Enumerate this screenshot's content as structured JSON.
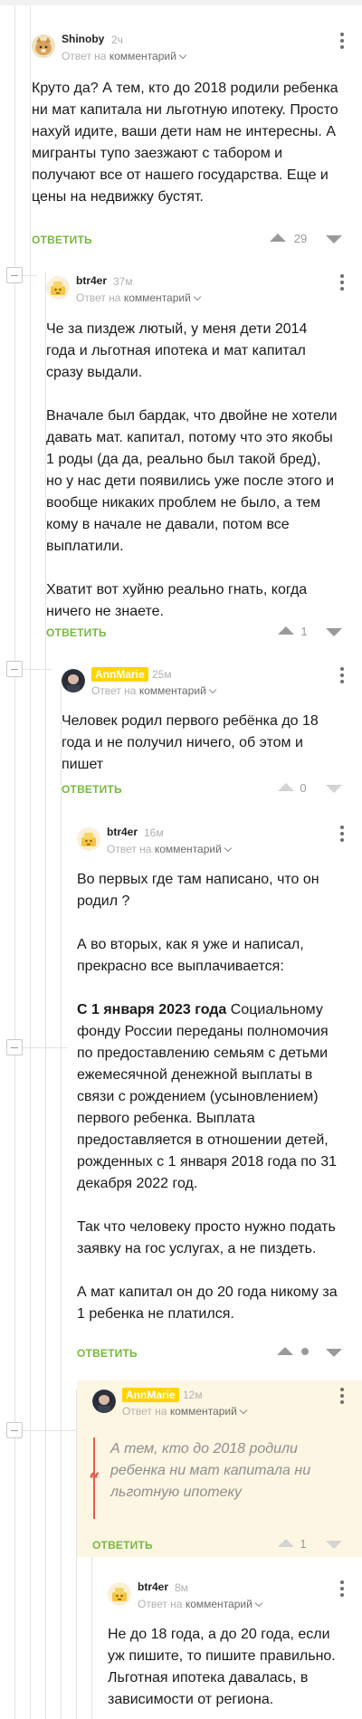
{
  "comments": [
    {
      "author": "Shinoby",
      "time": "2ч",
      "reply_prefix": "Ответ на",
      "reply_target": "комментарий",
      "paragraphs": [
        "Круто да? А тем, кто до 2018 родили ребенка ни мат капитала ни льготную ипотеку. Просто нахуй идите, ваши дети нам не интересны. А мигранты тупо заезжают с табором и получают все от нашего государства. Еще и цены на недвижку бустят."
      ],
      "reply_label": "ОТВЕТИТЬ",
      "score": "29"
    },
    {
      "author": "btr4er",
      "time": "37м",
      "reply_prefix": "Ответ на",
      "reply_target": "комментарий",
      "paragraphs": [
        "Че за пиздеж лютый, у меня дети 2014 года и льготная ипотека и мат капитал сразу выдали.",
        "Вначале был бардак, что двойне не хотели давать мат. капитал, потому что это якобы 1 роды (да да, реально был такой бред), но у нас дети появились уже после этого и вообще никаких проблем не было, а тем кому в начале не давали, потом все выплатили.",
        "Хватит вот хуйню реально гнать, когда ничего не знаете."
      ],
      "reply_label": "ОТВЕТИТЬ",
      "score": "1"
    },
    {
      "author": "AnnMarie",
      "time": "25м",
      "reply_prefix": "Ответ на",
      "reply_target": "комментарий",
      "paragraphs": [
        "Человек родил первого ребёнка до 18 года и не получил ничего, об этом и пишет"
      ],
      "reply_label": "ОТВЕТИТЬ",
      "score": "0"
    },
    {
      "author": "btr4er",
      "time": "16м",
      "reply_prefix": "Ответ на",
      "reply_target": "комментарий",
      "paragraphs": [
        "Во первых где там написано, что он родил ?",
        "А во вторых, как я уже и написал, прекрасно все выплачивается:",
        "Социальному фонду России переданы полномочия по предоставлению семьям с детьми ежемесячной денежной выплаты в связи с рождением (усыновлением) первого ребенка. Выплата предоставляется в отношении детей, рожденных с 1 января 2018 года по 31 декабря 2022 год.",
        "Так что человеку просто нужно подать заявку на гос услугах, а не пиздеть.",
        "А мат капитал он до 20 года никому за 1 ребенка не платился."
      ],
      "bold_lead": "С 1 января 2023 года",
      "reply_label": "ОТВЕТИТЬ"
    },
    {
      "author": "AnnMarie",
      "time": "12м",
      "reply_prefix": "Ответ на",
      "reply_target": "комментарий",
      "quote": "А тем, кто до 2018 родили ребенка ни мат капитала ни льготную ипотеку",
      "quote_mark": "“",
      "reply_label": "ОТВЕТИТЬ",
      "score": "1"
    },
    {
      "author": "btr4er",
      "time": "8м",
      "reply_prefix": "Ответ на",
      "reply_target": "комментарий",
      "paragraphs": [
        "Не до 18 года, а до 20 года, если уж пишите, то пишите правильно. Льготная ипотека давалась, в зависимости от региона."
      ]
    }
  ],
  "colors": {
    "accent_green": "#77b940",
    "badge_yellow": "#ffd400",
    "quote_red": "#e85a4f",
    "highlight_bg": "#fdf6e3"
  },
  "icons": {
    "collapse": "minus-box-icon",
    "more": "more-vertical-icon",
    "upvote": "arrow-up-icon",
    "downvote": "arrow-down-icon",
    "expand": "chevron-down-icon"
  }
}
